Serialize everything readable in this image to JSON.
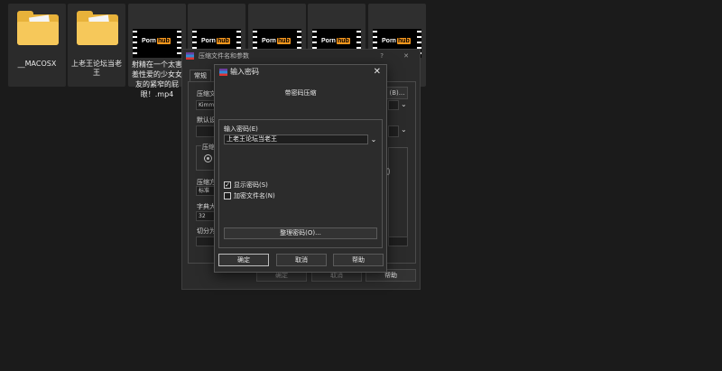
{
  "files": [
    {
      "type": "folder",
      "name": "__MACOSX"
    },
    {
      "type": "folder",
      "name": "上老王论坛当老王"
    },
    {
      "type": "video",
      "name": "射精在一个太害羞性爱的少女女友的紧窄的屁眼！.mp4",
      "logo_a": "Porn",
      "logo_b": "hub"
    },
    {
      "type": "video",
      "name": "",
      "logo_a": "Porn",
      "logo_b": "hub"
    },
    {
      "type": "video",
      "name": "",
      "logo_a": "Porn",
      "logo_b": "hub"
    },
    {
      "type": "video",
      "name": "",
      "logo_a": "Porn",
      "logo_b": "hub"
    },
    {
      "type": "video",
      "name": "",
      "logo_a": "Porn",
      "logo_b": "hub"
    }
  ],
  "back_dialog": {
    "title": "压缩文件名和参数",
    "help_glyph": "?",
    "close_glyph": "✕",
    "tab": "常规",
    "label_archive": "压缩文",
    "archive_value": "Kimmi",
    "browse_label": "(B)...",
    "label_default": "默认设",
    "label_format": "压缩",
    "label_method": "压缩方",
    "method_value": "标准",
    "label_dict": "字典大",
    "dict_value": "32",
    "label_split": "切分为",
    "ok": "确定",
    "cancel": "取消",
    "help": "帮助"
  },
  "dialog": {
    "title": "输入密码",
    "close_glyph": "✕",
    "heading": "带密码压缩",
    "password_label": "输入密码(E)",
    "password_value": "上老王论坛当老王",
    "dropdown_glyph": "⌄",
    "show_password_label": "显示密码(S)",
    "show_password_checked": true,
    "check_glyph": "✓",
    "encrypt_names_label": "加密文件名(N)",
    "encrypt_names_checked": false,
    "manage_button": "整理密码(O)...",
    "ok": "确定",
    "cancel": "取消",
    "help": "帮助"
  }
}
